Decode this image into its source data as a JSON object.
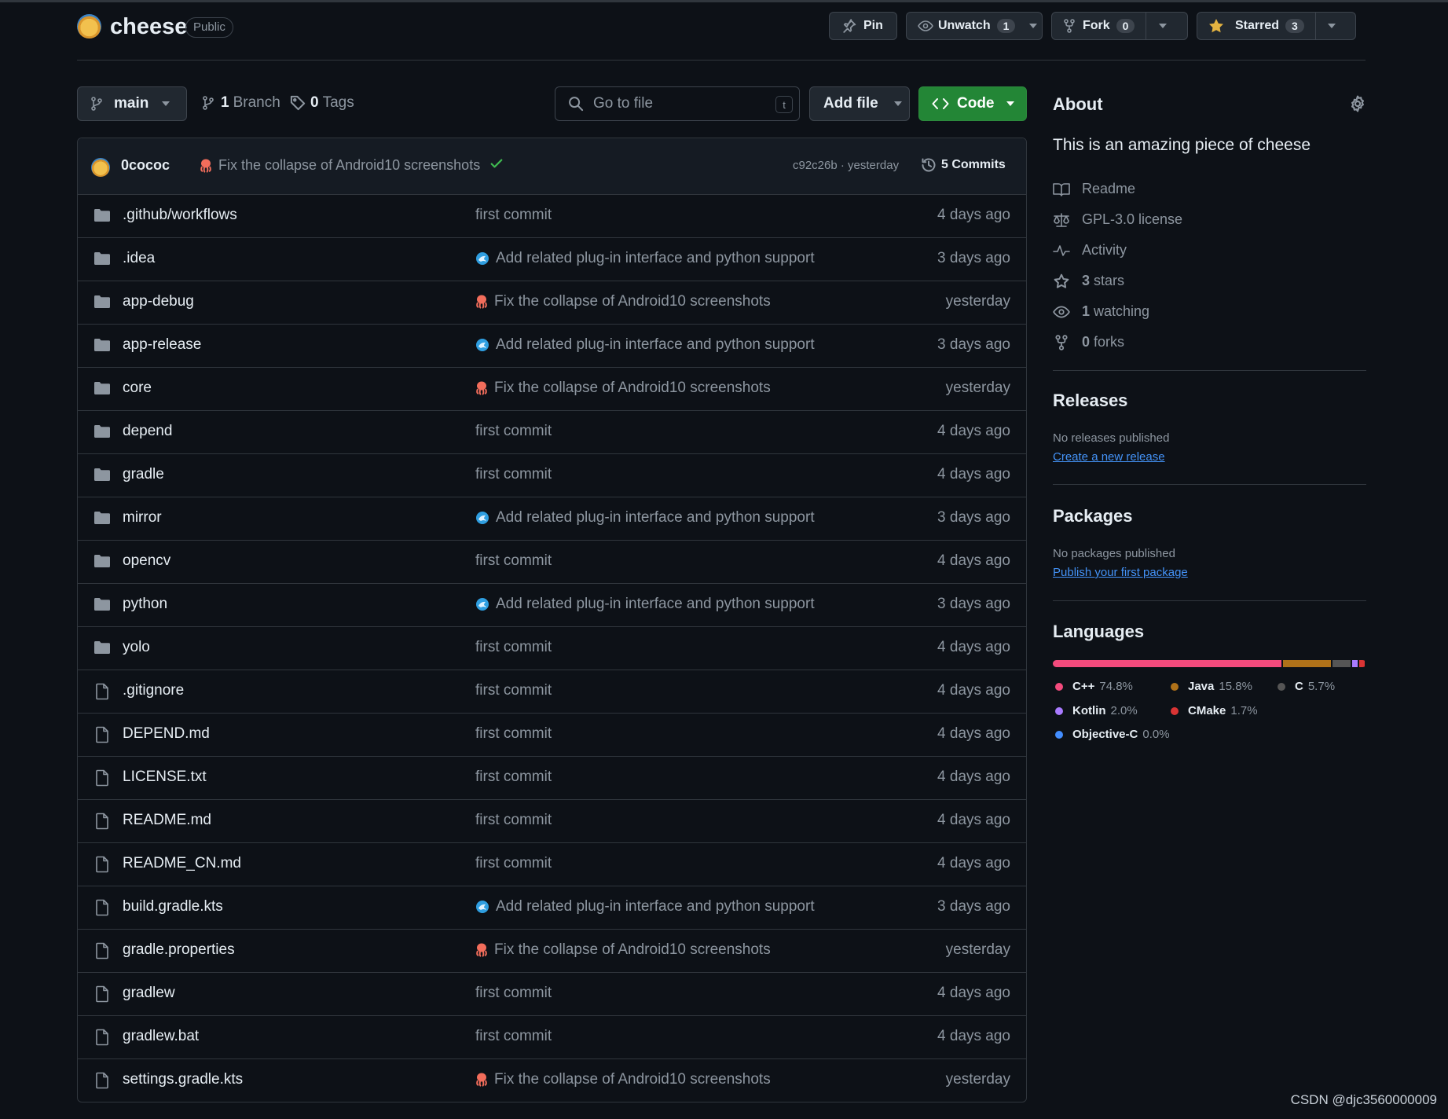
{
  "repo": {
    "name": "cheese",
    "visibility": "Public",
    "actions": {
      "pin_label": "Pin",
      "watch_label": "Unwatch",
      "watch_count": "1",
      "fork_label": "Fork",
      "fork_count": "0",
      "star_label": "Starred",
      "star_count": "3"
    }
  },
  "toolbar": {
    "branch": "main",
    "branch_count": "1",
    "branch_label": "Branch",
    "tag_count": "0",
    "tag_label": "Tags",
    "search_placeholder": "Go to file",
    "search_shortcut": "t",
    "add_file_label": "Add file",
    "code_label": "Code"
  },
  "latest_commit": {
    "author": "0cococ",
    "message": "Fix the collapse of Android10 screenshots",
    "hash_time": "c92c26b · yesterday",
    "commits_label": "5 Commits"
  },
  "files": [
    {
      "type": "dir",
      "name": ".github/workflows",
      "emoji": "",
      "message": "first commit",
      "time": "4 days ago"
    },
    {
      "type": "dir",
      "name": ".idea",
      "emoji": "dolphin",
      "message": "Add related plug-in interface and python support",
      "time": "3 days ago"
    },
    {
      "type": "dir",
      "name": "app-debug",
      "emoji": "octopus",
      "message": "Fix the collapse of Android10 screenshots",
      "time": "yesterday"
    },
    {
      "type": "dir",
      "name": "app-release",
      "emoji": "dolphin",
      "message": "Add related plug-in interface and python support",
      "time": "3 days ago"
    },
    {
      "type": "dir",
      "name": "core",
      "emoji": "octopus",
      "message": "Fix the collapse of Android10 screenshots",
      "time": "yesterday"
    },
    {
      "type": "dir",
      "name": "depend",
      "emoji": "",
      "message": "first commit",
      "time": "4 days ago"
    },
    {
      "type": "dir",
      "name": "gradle",
      "emoji": "",
      "message": "first commit",
      "time": "4 days ago"
    },
    {
      "type": "dir",
      "name": "mirror",
      "emoji": "dolphin",
      "message": "Add related plug-in interface and python support",
      "time": "3 days ago"
    },
    {
      "type": "dir",
      "name": "opencv",
      "emoji": "",
      "message": "first commit",
      "time": "4 days ago"
    },
    {
      "type": "dir",
      "name": "python",
      "emoji": "dolphin",
      "message": "Add related plug-in interface and python support",
      "time": "3 days ago"
    },
    {
      "type": "dir",
      "name": "yolo",
      "emoji": "",
      "message": "first commit",
      "time": "4 days ago"
    },
    {
      "type": "file",
      "name": ".gitignore",
      "emoji": "",
      "message": "first commit",
      "time": "4 days ago"
    },
    {
      "type": "file",
      "name": "DEPEND.md",
      "emoji": "",
      "message": "first commit",
      "time": "4 days ago"
    },
    {
      "type": "file",
      "name": "LICENSE.txt",
      "emoji": "",
      "message": "first commit",
      "time": "4 days ago"
    },
    {
      "type": "file",
      "name": "README.md",
      "emoji": "",
      "message": "first commit",
      "time": "4 days ago"
    },
    {
      "type": "file",
      "name": "README_CN.md",
      "emoji": "",
      "message": "first commit",
      "time": "4 days ago"
    },
    {
      "type": "file",
      "name": "build.gradle.kts",
      "emoji": "dolphin",
      "message": "Add related plug-in interface and python support",
      "time": "3 days ago"
    },
    {
      "type": "file",
      "name": "gradle.properties",
      "emoji": "octopus",
      "message": "Fix the collapse of Android10 screenshots",
      "time": "yesterday"
    },
    {
      "type": "file",
      "name": "gradlew",
      "emoji": "",
      "message": "first commit",
      "time": "4 days ago"
    },
    {
      "type": "file",
      "name": "gradlew.bat",
      "emoji": "",
      "message": "first commit",
      "time": "4 days ago"
    },
    {
      "type": "file",
      "name": "settings.gradle.kts",
      "emoji": "octopus",
      "message": "Fix the collapse of Android10 screenshots",
      "time": "yesterday"
    }
  ],
  "about": {
    "title": "About",
    "description": "This is an amazing piece of cheese",
    "readme": "Readme",
    "license": "GPL-3.0 license",
    "activity": "Activity",
    "stars_count": "3",
    "stars_label": "stars",
    "watching_count": "1",
    "watching_label": "watching",
    "forks_count": "0",
    "forks_label": "forks"
  },
  "releases": {
    "title": "Releases",
    "empty": "No releases published",
    "link": "Create a new release"
  },
  "packages": {
    "title": "Packages",
    "empty": "No packages published",
    "link": "Publish your first package"
  },
  "languages": {
    "title": "Languages",
    "items": [
      {
        "name": "C++",
        "percent": "74.8%",
        "value": 74.8,
        "color": "#f34b7d"
      },
      {
        "name": "Java",
        "percent": "15.8%",
        "value": 15.8,
        "color": "#b07219"
      },
      {
        "name": "C",
        "percent": "5.7%",
        "value": 5.7,
        "color": "#555555"
      },
      {
        "name": "Kotlin",
        "percent": "2.0%",
        "value": 2.0,
        "color": "#a97bff"
      },
      {
        "name": "CMake",
        "percent": "1.7%",
        "value": 1.7,
        "color": "#da3434"
      },
      {
        "name": "Objective-C",
        "percent": "0.0%",
        "value": 0.0,
        "color": "#438eff"
      }
    ]
  },
  "watermark": "CSDN @djc3560000009"
}
